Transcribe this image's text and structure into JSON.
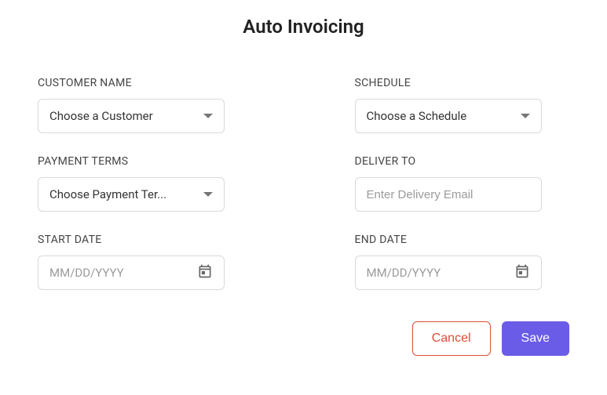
{
  "title": "Auto Invoicing",
  "fields": {
    "customer": {
      "label": "CUSTOMER NAME",
      "placeholder": "Choose a Customer"
    },
    "schedule": {
      "label": "SCHEDULE",
      "placeholder": "Choose a Schedule"
    },
    "paymentTerms": {
      "label": "PAYMENT TERMS",
      "placeholder": "Choose Payment Ter..."
    },
    "deliverTo": {
      "label": "DELIVER TO",
      "placeholder": "Enter Delivery Email"
    },
    "startDate": {
      "label": "START DATE",
      "placeholder": "MM/DD/YYYY"
    },
    "endDate": {
      "label": "END DATE",
      "placeholder": "MM/DD/YYYY"
    }
  },
  "actions": {
    "cancel": "Cancel",
    "save": "Save"
  }
}
